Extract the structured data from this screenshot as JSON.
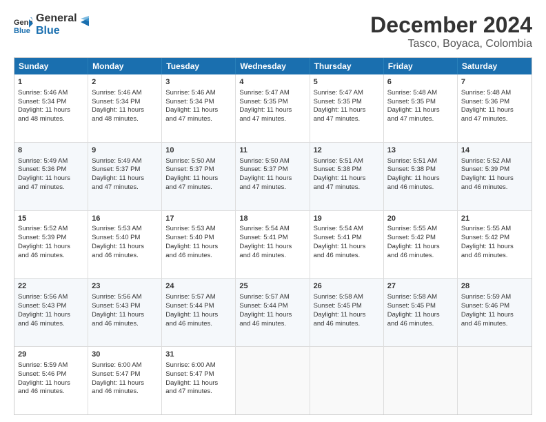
{
  "logo": {
    "line1": "General",
    "line2": "Blue"
  },
  "title": "December 2024",
  "subtitle": "Tasco, Boyaca, Colombia",
  "header_days": [
    "Sunday",
    "Monday",
    "Tuesday",
    "Wednesday",
    "Thursday",
    "Friday",
    "Saturday"
  ],
  "weeks": [
    [
      {
        "day": "1",
        "lines": [
          "Sunrise: 5:46 AM",
          "Sunset: 5:34 PM",
          "Daylight: 11 hours",
          "and 48 minutes."
        ]
      },
      {
        "day": "2",
        "lines": [
          "Sunrise: 5:46 AM",
          "Sunset: 5:34 PM",
          "Daylight: 11 hours",
          "and 48 minutes."
        ]
      },
      {
        "day": "3",
        "lines": [
          "Sunrise: 5:46 AM",
          "Sunset: 5:34 PM",
          "Daylight: 11 hours",
          "and 47 minutes."
        ]
      },
      {
        "day": "4",
        "lines": [
          "Sunrise: 5:47 AM",
          "Sunset: 5:35 PM",
          "Daylight: 11 hours",
          "and 47 minutes."
        ]
      },
      {
        "day": "5",
        "lines": [
          "Sunrise: 5:47 AM",
          "Sunset: 5:35 PM",
          "Daylight: 11 hours",
          "and 47 minutes."
        ]
      },
      {
        "day": "6",
        "lines": [
          "Sunrise: 5:48 AM",
          "Sunset: 5:35 PM",
          "Daylight: 11 hours",
          "and 47 minutes."
        ]
      },
      {
        "day": "7",
        "lines": [
          "Sunrise: 5:48 AM",
          "Sunset: 5:36 PM",
          "Daylight: 11 hours",
          "and 47 minutes."
        ]
      }
    ],
    [
      {
        "day": "8",
        "lines": [
          "Sunrise: 5:49 AM",
          "Sunset: 5:36 PM",
          "Daylight: 11 hours",
          "and 47 minutes."
        ]
      },
      {
        "day": "9",
        "lines": [
          "Sunrise: 5:49 AM",
          "Sunset: 5:37 PM",
          "Daylight: 11 hours",
          "and 47 minutes."
        ]
      },
      {
        "day": "10",
        "lines": [
          "Sunrise: 5:50 AM",
          "Sunset: 5:37 PM",
          "Daylight: 11 hours",
          "and 47 minutes."
        ]
      },
      {
        "day": "11",
        "lines": [
          "Sunrise: 5:50 AM",
          "Sunset: 5:37 PM",
          "Daylight: 11 hours",
          "and 47 minutes."
        ]
      },
      {
        "day": "12",
        "lines": [
          "Sunrise: 5:51 AM",
          "Sunset: 5:38 PM",
          "Daylight: 11 hours",
          "and 47 minutes."
        ]
      },
      {
        "day": "13",
        "lines": [
          "Sunrise: 5:51 AM",
          "Sunset: 5:38 PM",
          "Daylight: 11 hours",
          "and 46 minutes."
        ]
      },
      {
        "day": "14",
        "lines": [
          "Sunrise: 5:52 AM",
          "Sunset: 5:39 PM",
          "Daylight: 11 hours",
          "and 46 minutes."
        ]
      }
    ],
    [
      {
        "day": "15",
        "lines": [
          "Sunrise: 5:52 AM",
          "Sunset: 5:39 PM",
          "Daylight: 11 hours",
          "and 46 minutes."
        ]
      },
      {
        "day": "16",
        "lines": [
          "Sunrise: 5:53 AM",
          "Sunset: 5:40 PM",
          "Daylight: 11 hours",
          "and 46 minutes."
        ]
      },
      {
        "day": "17",
        "lines": [
          "Sunrise: 5:53 AM",
          "Sunset: 5:40 PM",
          "Daylight: 11 hours",
          "and 46 minutes."
        ]
      },
      {
        "day": "18",
        "lines": [
          "Sunrise: 5:54 AM",
          "Sunset: 5:41 PM",
          "Daylight: 11 hours",
          "and 46 minutes."
        ]
      },
      {
        "day": "19",
        "lines": [
          "Sunrise: 5:54 AM",
          "Sunset: 5:41 PM",
          "Daylight: 11 hours",
          "and 46 minutes."
        ]
      },
      {
        "day": "20",
        "lines": [
          "Sunrise: 5:55 AM",
          "Sunset: 5:42 PM",
          "Daylight: 11 hours",
          "and 46 minutes."
        ]
      },
      {
        "day": "21",
        "lines": [
          "Sunrise: 5:55 AM",
          "Sunset: 5:42 PM",
          "Daylight: 11 hours",
          "and 46 minutes."
        ]
      }
    ],
    [
      {
        "day": "22",
        "lines": [
          "Sunrise: 5:56 AM",
          "Sunset: 5:43 PM",
          "Daylight: 11 hours",
          "and 46 minutes."
        ]
      },
      {
        "day": "23",
        "lines": [
          "Sunrise: 5:56 AM",
          "Sunset: 5:43 PM",
          "Daylight: 11 hours",
          "and 46 minutes."
        ]
      },
      {
        "day": "24",
        "lines": [
          "Sunrise: 5:57 AM",
          "Sunset: 5:44 PM",
          "Daylight: 11 hours",
          "and 46 minutes."
        ]
      },
      {
        "day": "25",
        "lines": [
          "Sunrise: 5:57 AM",
          "Sunset: 5:44 PM",
          "Daylight: 11 hours",
          "and 46 minutes."
        ]
      },
      {
        "day": "26",
        "lines": [
          "Sunrise: 5:58 AM",
          "Sunset: 5:45 PM",
          "Daylight: 11 hours",
          "and 46 minutes."
        ]
      },
      {
        "day": "27",
        "lines": [
          "Sunrise: 5:58 AM",
          "Sunset: 5:45 PM",
          "Daylight: 11 hours",
          "and 46 minutes."
        ]
      },
      {
        "day": "28",
        "lines": [
          "Sunrise: 5:59 AM",
          "Sunset: 5:46 PM",
          "Daylight: 11 hours",
          "and 46 minutes."
        ]
      }
    ],
    [
      {
        "day": "29",
        "lines": [
          "Sunrise: 5:59 AM",
          "Sunset: 5:46 PM",
          "Daylight: 11 hours",
          "and 46 minutes."
        ]
      },
      {
        "day": "30",
        "lines": [
          "Sunrise: 6:00 AM",
          "Sunset: 5:47 PM",
          "Daylight: 11 hours",
          "and 46 minutes."
        ]
      },
      {
        "day": "31",
        "lines": [
          "Sunrise: 6:00 AM",
          "Sunset: 5:47 PM",
          "Daylight: 11 hours",
          "and 47 minutes."
        ]
      },
      {
        "day": "",
        "lines": []
      },
      {
        "day": "",
        "lines": []
      },
      {
        "day": "",
        "lines": []
      },
      {
        "day": "",
        "lines": []
      }
    ]
  ]
}
